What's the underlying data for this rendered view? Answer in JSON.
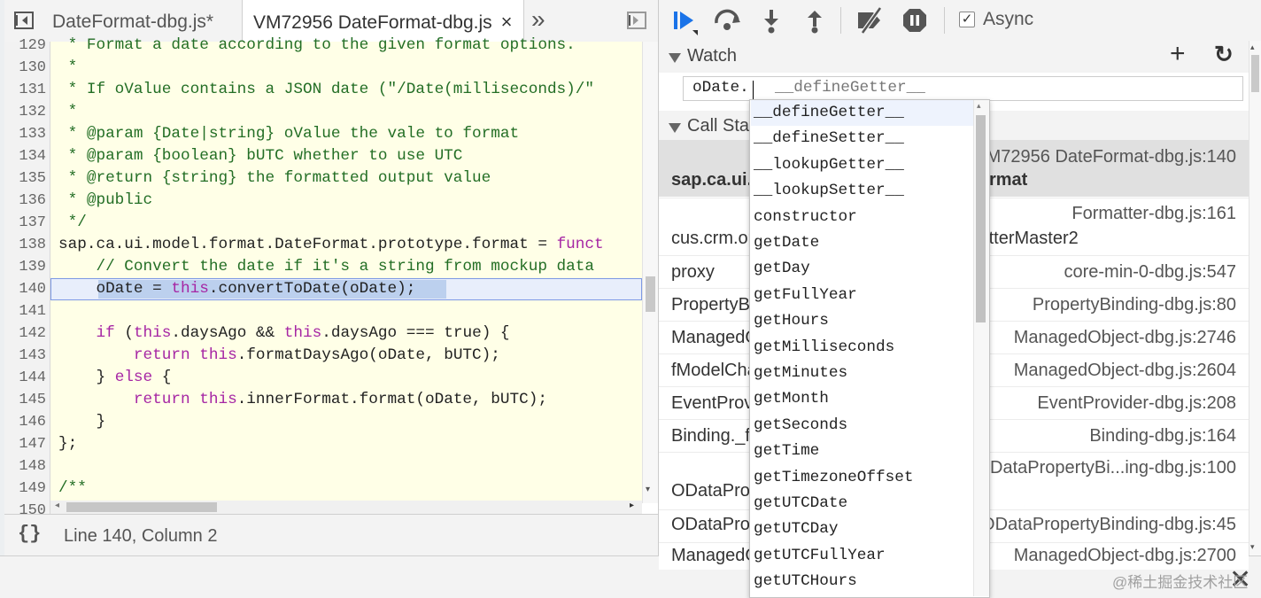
{
  "editor": {
    "tabs": [
      {
        "label": "DateFormat-dbg.js*"
      },
      {
        "label": "VM72956 DateFormat-dbg.js",
        "close": "×"
      }
    ],
    "more_tabs_glyph": "»",
    "lines": [
      {
        "n": "129",
        "segs": [
          {
            "t": " * Format a date according to the given format options.",
            "c": "com"
          }
        ]
      },
      {
        "n": "130",
        "segs": [
          {
            "t": " *",
            "c": "com"
          }
        ]
      },
      {
        "n": "131",
        "segs": [
          {
            "t": " * If oValue contains a JSON date (\"/Date(milliseconds)/\"",
            "c": "com"
          }
        ]
      },
      {
        "n": "132",
        "segs": [
          {
            "t": " *",
            "c": "com"
          }
        ]
      },
      {
        "n": "133",
        "segs": [
          {
            "t": " * @param {Date|string} oValue the vale to format",
            "c": "com"
          }
        ]
      },
      {
        "n": "134",
        "segs": [
          {
            "t": " * @param {boolean} bUTC whether to use UTC",
            "c": "com"
          }
        ]
      },
      {
        "n": "135",
        "segs": [
          {
            "t": " * @return {string} the formatted output value",
            "c": "com"
          }
        ]
      },
      {
        "n": "136",
        "segs": [
          {
            "t": " * @public",
            "c": "com"
          }
        ]
      },
      {
        "n": "137",
        "segs": [
          {
            "t": " */",
            "c": "com"
          }
        ]
      },
      {
        "n": "138",
        "segs": [
          {
            "t": "sap.ca.ui.model.format.DateFormat.prototype.format = ",
            "c": "plain"
          },
          {
            "t": "funct",
            "c": "kw"
          }
        ]
      },
      {
        "n": "139",
        "segs": [
          {
            "t": "    // Convert the date if it's a string from mockup data",
            "c": "com"
          }
        ]
      },
      {
        "n": "140",
        "segs": [
          {
            "t": "    oDate = ",
            "c": "plain"
          },
          {
            "t": "this",
            "c": "kw"
          },
          {
            "t": ".convertToDate(oDate);",
            "c": "plain"
          }
        ]
      },
      {
        "n": "141",
        "segs": []
      },
      {
        "n": "142",
        "segs": [
          {
            "t": "    ",
            "c": "plain"
          },
          {
            "t": "if",
            "c": "kw"
          },
          {
            "t": " (",
            "c": "plain"
          },
          {
            "t": "this",
            "c": "kw"
          },
          {
            "t": ".daysAgo && ",
            "c": "plain"
          },
          {
            "t": "this",
            "c": "kw"
          },
          {
            "t": ".daysAgo === true) {",
            "c": "plain"
          }
        ]
      },
      {
        "n": "143",
        "segs": [
          {
            "t": "        ",
            "c": "plain"
          },
          {
            "t": "return this",
            "c": "kw"
          },
          {
            "t": ".formatDaysAgo(oDate, bUTC);",
            "c": "plain"
          }
        ]
      },
      {
        "n": "144",
        "segs": [
          {
            "t": "    } ",
            "c": "plain"
          },
          {
            "t": "else",
            "c": "kw"
          },
          {
            "t": " {",
            "c": "plain"
          }
        ]
      },
      {
        "n": "145",
        "segs": [
          {
            "t": "        ",
            "c": "plain"
          },
          {
            "t": "return this",
            "c": "kw"
          },
          {
            "t": ".innerFormat.format(oDate, bUTC);",
            "c": "plain"
          }
        ]
      },
      {
        "n": "146",
        "segs": [
          {
            "t": "    }",
            "c": "plain"
          }
        ]
      },
      {
        "n": "147",
        "segs": [
          {
            "t": "};",
            "c": "plain"
          }
        ]
      },
      {
        "n": "148",
        "segs": []
      },
      {
        "n": "149",
        "segs": [
          {
            "t": "/**",
            "c": "com"
          }
        ]
      },
      {
        "n": "150",
        "segs": []
      }
    ],
    "status_icon": "{}",
    "status_text": "Line 140, Column 2"
  },
  "debugger": {
    "async_label": "Async",
    "async_checked": true,
    "watch": {
      "title": "Watch",
      "add_glyph": "+",
      "refresh_glyph": "↻",
      "input_typed": "oDate.",
      "input_hint": "__defineGetter__"
    },
    "call_stack": {
      "title": "Call Stack",
      "frames": [
        {
          "fn": "sap.ca.ui.model.format.DateFormat.format",
          "loc": "VM72956 DateFormat-dbg.js:140",
          "current": true
        },
        {
          "fn": "cus.crm.opportunity.util.Formatter.FormatterMaster2",
          "loc": "Formatter-dbg.js:161"
        },
        {
          "fn": "proxy",
          "loc": "core-min-0-dbg.js:547"
        },
        {
          "fn": "PropertyBinding._toExternalValue",
          "loc": "PropertyBinding-dbg.js:80"
        },
        {
          "fn": "ManagedObject.updateProperty",
          "loc": "ManagedObject-dbg.js:2746"
        },
        {
          "fn": "fModelChangeHandler",
          "loc": "ManagedObject-dbg.js:2604"
        },
        {
          "fn": "EventProvider.fireEvent",
          "loc": "EventProvider-dbg.js:208"
        },
        {
          "fn": "Binding._fireChange",
          "loc": "Binding-dbg.js:164"
        },
        {
          "fn": "ODataPropertyBinding.checkUpdate",
          "loc": "ODataPropertyBi...ing-dbg.js:100"
        },
        {
          "fn": "ODataPropertyBinding.initialize",
          "loc": "ODataPropertyBinding-dbg.js:45"
        },
        {
          "fn": "ManagedObject.bindProperty",
          "loc": "ManagedObject-dbg.js:2700"
        }
      ]
    }
  },
  "autocomplete": {
    "items": [
      "__defineGetter__",
      "__defineSetter__",
      "__lookupGetter__",
      "__lookupSetter__",
      "constructor",
      "getDate",
      "getDay",
      "getFullYear",
      "getHours",
      "getMilliseconds",
      "getMinutes",
      "getMonth",
      "getSeconds",
      "getTime",
      "getTimezoneOffset",
      "getUTCDate",
      "getUTCDay",
      "getUTCFullYear",
      "getUTCHours"
    ],
    "selected_index": 0
  },
  "drawer": {
    "close_glyph": "✕"
  },
  "watermark": "@稀土掘金技术社区",
  "colors": {
    "comment": "#236e25",
    "keyword": "#a626a4",
    "code_bg": "#ffffe7",
    "selection": "#bcd0ee",
    "accent": "#1a73e8"
  }
}
